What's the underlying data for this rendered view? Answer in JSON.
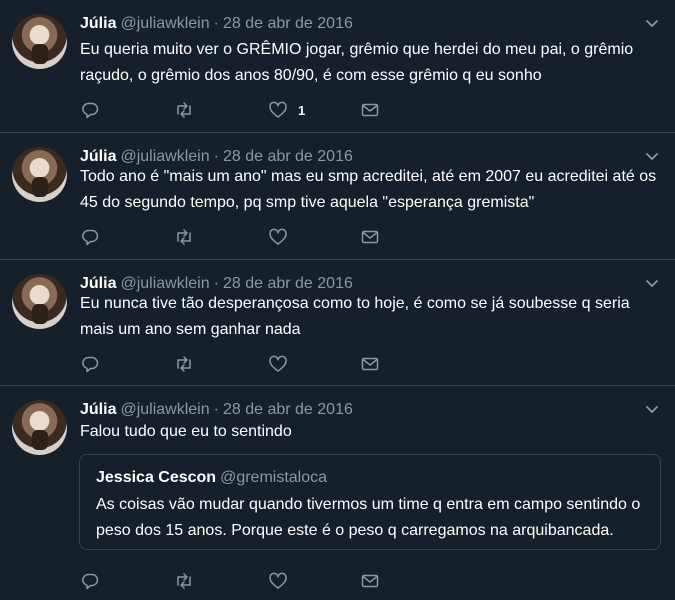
{
  "tweets": [
    {
      "name": "Júlia",
      "handle": "@juliawklein",
      "dot": "·",
      "date": "28 de abr de 2016",
      "text": "Eu queria muito ver o GRÊMIO jogar, grêmio que herdei do meu pai, o grêmio raçudo, o grêmio dos anos 80/90, é com esse grêmio q eu sonho",
      "like_count": "1"
    },
    {
      "name": "Júlia",
      "handle": "@juliawklein",
      "dot": "·",
      "date": "28 de abr de 2016",
      "text": "Todo ano é \"mais um ano\" mas eu smp acreditei, até em 2007 eu acreditei até os 45 do segundo tempo, pq smp tive aquela \"esperança gremista\""
    },
    {
      "name": "Júlia",
      "handle": "@juliawklein",
      "dot": "·",
      "date": "28 de abr de 2016",
      "text": "Eu nunca tive tão desperançosa como to hoje, é como se já soubesse q seria mais um ano sem ganhar nada"
    },
    {
      "name": "Júlia",
      "handle": "@juliawklein",
      "dot": "·",
      "date": "28 de abr de 2016",
      "text": "Falou tudo que eu to sentindo",
      "quoted": {
        "name": "Jessica Cescon",
        "handle": "@gremistaloca",
        "text": "As coisas vão mudar quando tivermos um time q entra em campo sentindo o peso dos 15 anos. Porque este é o peso q carregamos na arquibancada."
      }
    }
  ],
  "icons": {
    "reply": "reply-icon",
    "retweet": "retweet-icon",
    "like": "heart-icon",
    "dm": "envelope-icon",
    "menu": "chevron-down-icon"
  },
  "colors": {
    "background": "#15202b",
    "border": "#38444d",
    "secondary_text": "#8899a6",
    "primary_text": "#ffffff"
  }
}
